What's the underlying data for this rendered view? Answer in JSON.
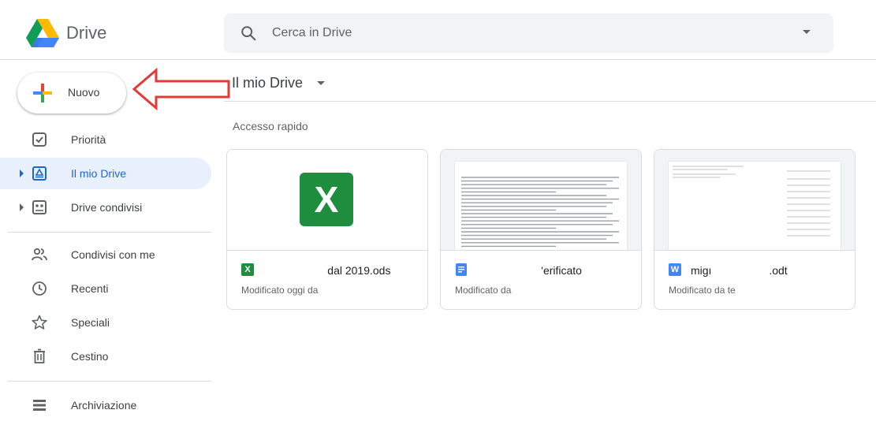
{
  "header": {
    "brand": "Drive",
    "search_placeholder": "Cerca in Drive",
    "logo_icon": "google-drive-logo",
    "search_icon": "search-icon"
  },
  "new_button": {
    "label": "Nuovo"
  },
  "sidebar": {
    "items": [
      {
        "label": "Priorità",
        "icon": "priority-icon"
      },
      {
        "label": "Il mio Drive",
        "icon": "my-drive-icon",
        "active": true
      },
      {
        "label": "Drive condivisi",
        "icon": "shared-drives-icon"
      },
      {
        "label": "Condivisi con me",
        "icon": "shared-with-me-icon"
      },
      {
        "label": "Recenti",
        "icon": "clock-icon"
      },
      {
        "label": "Speciali",
        "icon": "star-icon"
      },
      {
        "label": "Cestino",
        "icon": "trash-icon"
      },
      {
        "label": "Archiviazione",
        "icon": "storage-icon"
      }
    ]
  },
  "main": {
    "title": "Il mio Drive",
    "section_title": "Accesso rapido",
    "cards": [
      {
        "file_name": "                             dal 2019.ods",
        "meta": "Modificato oggi da",
        "type": "spreadsheet",
        "icon_text": "X",
        "color": "#1e8e3e"
      },
      {
        "file_name": "                             'erificato",
        "meta": "Modificato da",
        "type": "document",
        "icon_text": "",
        "color": "#4285f4"
      },
      {
        "file_name": "migı                          .odt",
        "meta": "Modificato da te",
        "type": "word",
        "icon_text": "W",
        "color": "#4285f4"
      }
    ]
  },
  "colors": {
    "accent": "#1967d2",
    "active_bg": "#e8f0fe",
    "arrow": "#e53935"
  }
}
